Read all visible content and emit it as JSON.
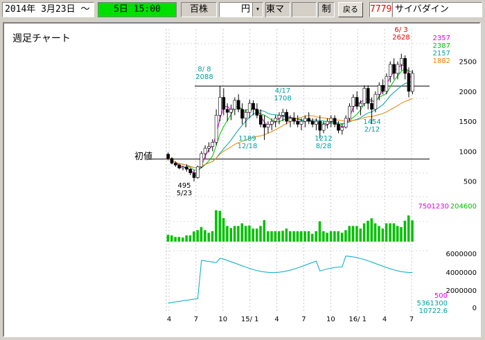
{
  "toolbar": {
    "date": "2014年 3月23日 ～",
    "period": "5日 15:00",
    "unit_label": "百株",
    "currency": "円",
    "dropdown_arrow": "▾",
    "market": "東マ",
    "blank": "",
    "limit_label": "制",
    "back_button": "戻る",
    "code": "7779",
    "company": "サイバダイン"
  },
  "chart": {
    "title": "週足チャート",
    "first_price_label": "初値",
    "annotations": {
      "high_date": "6/ 3",
      "high_value": "2628",
      "peak1_date": "8/ 8",
      "peak1_value": "2088",
      "peak2_date": "4/17",
      "peak2_value": "1708",
      "low1_value": "495",
      "low1_date": "5/23",
      "low2_value": "1189",
      "low2_date": "12/18",
      "low3_value": "1212",
      "low3_date": "8/28",
      "low4_value": "1454",
      "low4_date": "2/12"
    },
    "price_legend": [
      "2357",
      "2387",
      "2157",
      "1882"
    ],
    "volume_legend": [
      "7501230",
      "204600"
    ],
    "ind_legend": [
      "500",
      "5361300",
      "10722.6"
    ],
    "y_ticks": [
      "2500",
      "2000",
      "1500",
      "1000",
      "500"
    ],
    "ind_ticks": [
      "6000000",
      "4000000",
      "2000000",
      "0"
    ],
    "x_labels": [
      "4",
      "7",
      "10",
      "15/ 1",
      "4",
      "7",
      "10",
      "16/ 1",
      "4",
      "7"
    ]
  },
  "chart_data": {
    "type": "candlestick",
    "ylim": [
      300,
      2900
    ],
    "reference_lines": [
      2088,
      869
    ],
    "ohlc_approx": [
      [
        950,
        980,
        850,
        880
      ],
      [
        880,
        900,
        780,
        800
      ],
      [
        800,
        830,
        740,
        770
      ],
      [
        770,
        790,
        700,
        720
      ],
      [
        720,
        760,
        680,
        740
      ],
      [
        740,
        780,
        660,
        700
      ],
      [
        700,
        720,
        600,
        640
      ],
      [
        640,
        690,
        495,
        560
      ],
      [
        560,
        760,
        540,
        740
      ],
      [
        740,
        1000,
        720,
        960
      ],
      [
        960,
        1100,
        880,
        1050
      ],
      [
        1050,
        1150,
        980,
        1080
      ],
      [
        1080,
        1200,
        1000,
        1150
      ],
      [
        1150,
        1700,
        1100,
        1600
      ],
      [
        1600,
        2088,
        1500,
        1900
      ],
      [
        1900,
        2050,
        1600,
        1700
      ],
      [
        1700,
        1800,
        1500,
        1650
      ],
      [
        1650,
        1780,
        1520,
        1700
      ],
      [
        1700,
        1900,
        1600,
        1850
      ],
      [
        1850,
        1950,
        1650,
        1700
      ],
      [
        1700,
        1800,
        1450,
        1550
      ],
      [
        1550,
        1700,
        1400,
        1650
      ],
      [
        1650,
        1860,
        1550,
        1800
      ],
      [
        1800,
        1850,
        1600,
        1700
      ],
      [
        1700,
        1800,
        1550,
        1600
      ],
      [
        1600,
        1700,
        1400,
        1450
      ],
      [
        1450,
        1600,
        1189,
        1400
      ],
      [
        1400,
        1500,
        1300,
        1450
      ],
      [
        1450,
        1550,
        1350,
        1500
      ],
      [
        1500,
        1600,
        1400,
        1550
      ],
      [
        1550,
        1650,
        1450,
        1600
      ],
      [
        1600,
        1708,
        1500,
        1650
      ],
      [
        1650,
        1700,
        1450,
        1500
      ],
      [
        1500,
        1600,
        1400,
        1550
      ],
      [
        1550,
        1650,
        1450,
        1500
      ],
      [
        1500,
        1600,
        1400,
        1450
      ],
      [
        1450,
        1550,
        1350,
        1500
      ],
      [
        1500,
        1600,
        1400,
        1550
      ],
      [
        1550,
        1650,
        1450,
        1500
      ],
      [
        1500,
        1550,
        1400,
        1450
      ],
      [
        1450,
        1550,
        1350,
        1500
      ],
      [
        1500,
        1600,
        1212,
        1350
      ],
      [
        1350,
        1500,
        1300,
        1450
      ],
      [
        1450,
        1550,
        1380,
        1500
      ],
      [
        1500,
        1600,
        1400,
        1550
      ],
      [
        1550,
        1600,
        1400,
        1450
      ],
      [
        1450,
        1500,
        1300,
        1350
      ],
      [
        1350,
        1450,
        1280,
        1400
      ],
      [
        1400,
        1600,
        1380,
        1550
      ],
      [
        1550,
        1800,
        1500,
        1750
      ],
      [
        1750,
        1950,
        1650,
        1900
      ],
      [
        1900,
        2000,
        1700,
        1750
      ],
      [
        1750,
        1850,
        1600,
        1800
      ],
      [
        1800,
        2100,
        1750,
        2050
      ],
      [
        2050,
        2100,
        1700,
        1800
      ],
      [
        1800,
        1900,
        1454,
        1700
      ],
      [
        1700,
        2000,
        1650,
        1950
      ],
      [
        1950,
        2150,
        1850,
        2100
      ],
      [
        2100,
        2200,
        1950,
        2000
      ],
      [
        2000,
        2300,
        1950,
        2250
      ],
      [
        2250,
        2500,
        2150,
        2450
      ],
      [
        2450,
        2550,
        2200,
        2300
      ],
      [
        2300,
        2500,
        2200,
        2450
      ],
      [
        2450,
        2628,
        2350,
        2550
      ],
      [
        2550,
        2600,
        2200,
        2300
      ],
      [
        2300,
        2400,
        1900,
        2000
      ],
      [
        2000,
        2357,
        1950,
        2300
      ]
    ],
    "volume_max": 7501230
  }
}
